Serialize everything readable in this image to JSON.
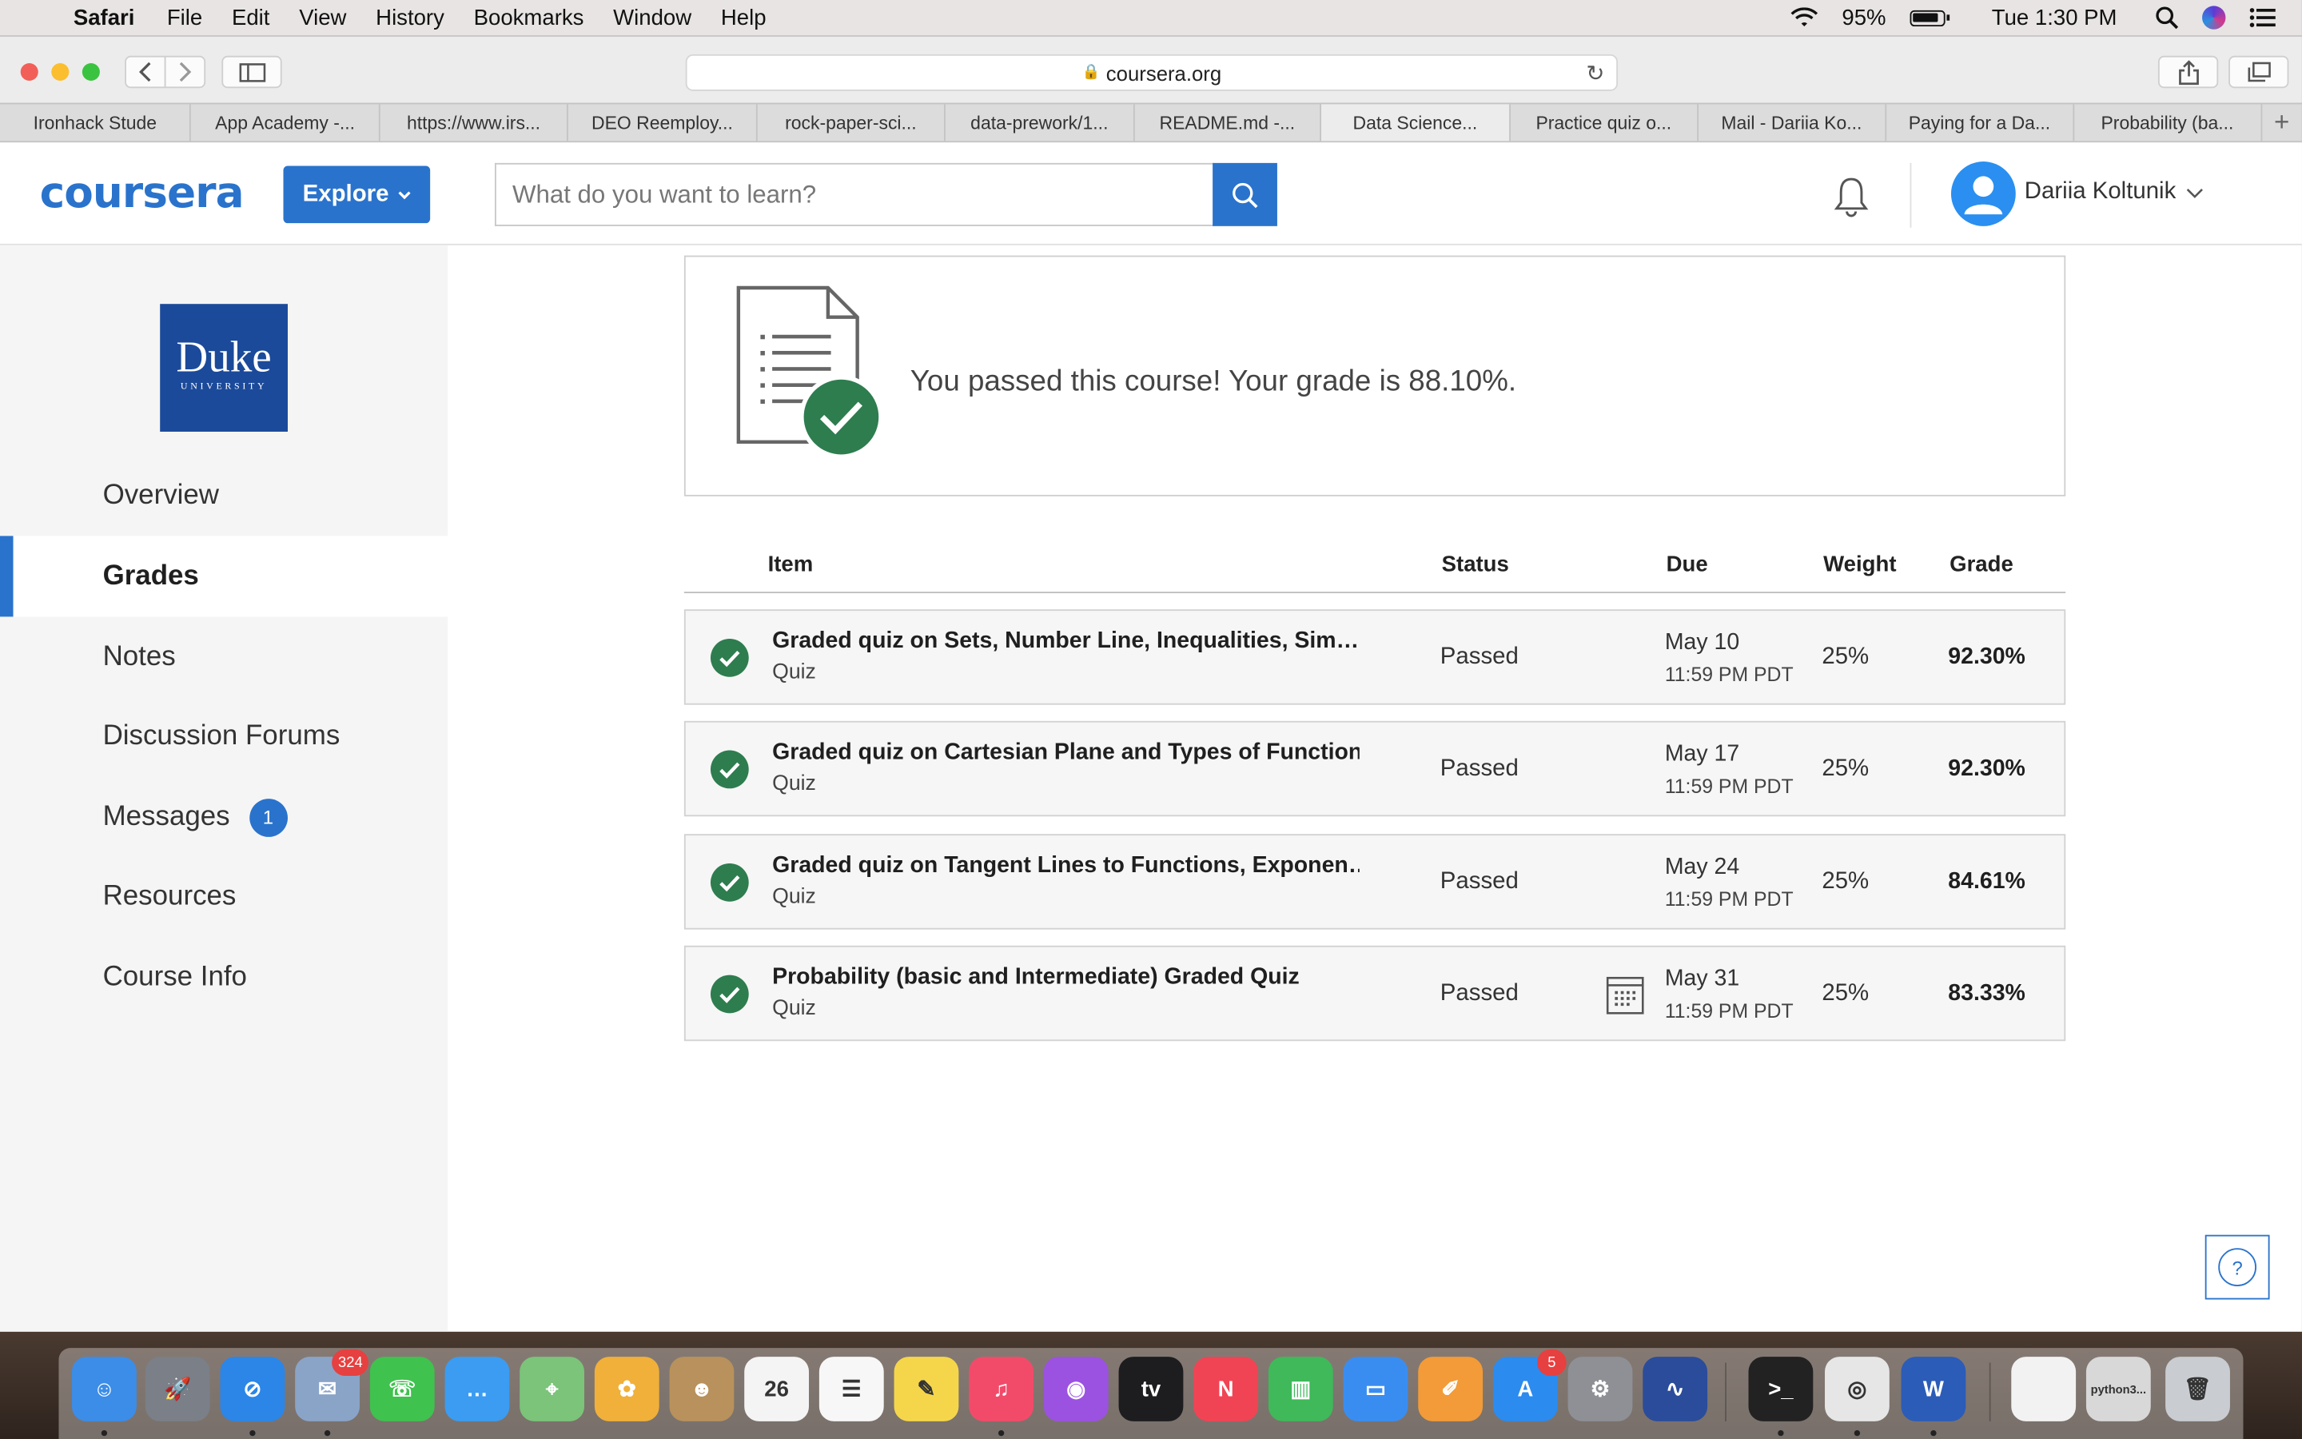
{
  "menubar": {
    "app": "Safari",
    "items": [
      "File",
      "Edit",
      "View",
      "History",
      "Bookmarks",
      "Window",
      "Help"
    ],
    "battery": "95%",
    "clock": "Tue 1:30 PM"
  },
  "browser": {
    "url": "coursera.org",
    "tabs": [
      {
        "label": "Ironhack Stude",
        "active": false
      },
      {
        "label": "App Academy -...",
        "active": false
      },
      {
        "label": "https://www.irs...",
        "active": false
      },
      {
        "label": "DEO Reemploy...",
        "active": false
      },
      {
        "label": "rock-paper-sci...",
        "active": false
      },
      {
        "label": "data-prework/1...",
        "active": false
      },
      {
        "label": "README.md -...",
        "active": false
      },
      {
        "label": "Data Science...",
        "active": true
      },
      {
        "label": "Practice quiz o...",
        "active": false
      },
      {
        "label": "Mail - Dariia Ko...",
        "active": false
      },
      {
        "label": "Paying for a Da...",
        "active": false
      },
      {
        "label": "Probability (ba...",
        "active": false
      }
    ]
  },
  "header": {
    "logo": "coursera",
    "explore": "Explore",
    "search_placeholder": "What do you want to learn?",
    "user_name": "Dariia Koltunik"
  },
  "sidebar": {
    "logo_name": "Duke",
    "logo_sub": "UNIVERSITY",
    "items": [
      {
        "label": "Overview",
        "active": false
      },
      {
        "label": "Grades",
        "active": true
      },
      {
        "label": "Notes",
        "active": false
      },
      {
        "label": "Discussion Forums",
        "active": false
      },
      {
        "label": "Messages",
        "active": false,
        "badge": "1"
      },
      {
        "label": "Resources",
        "active": false
      },
      {
        "label": "Course Info",
        "active": false
      }
    ]
  },
  "banner": {
    "text": "You passed this course! Your grade is 88.10%."
  },
  "table": {
    "headers": {
      "item": "Item",
      "status": "Status",
      "due": "Due",
      "weight": "Weight",
      "grade": "Grade"
    },
    "rows": [
      {
        "title": "Graded quiz on Sets, Number Line, Inequalities, Sim…",
        "type": "Quiz",
        "status": "Passed",
        "due_date": "May 10",
        "due_time": "11:59 PM PDT",
        "weight": "25%",
        "grade": "92.30%"
      },
      {
        "title": "Graded quiz on Cartesian Plane and Types of Function",
        "type": "Quiz",
        "status": "Passed",
        "due_date": "May 17",
        "due_time": "11:59 PM PDT",
        "weight": "25%",
        "grade": "92.30%"
      },
      {
        "title": "Graded quiz on Tangent Lines to Functions, Exponen…",
        "type": "Quiz",
        "status": "Passed",
        "due_date": "May 24",
        "due_time": "11:59 PM PDT",
        "weight": "25%",
        "grade": "84.61%"
      },
      {
        "title": "Probability (basic and Intermediate) Graded Quiz",
        "type": "Quiz",
        "status": "Passed",
        "due_date": "May 31",
        "due_time": "11:59 PM PDT",
        "weight": "25%",
        "grade": "83.33%",
        "calendar_icon": true
      }
    ]
  },
  "help": {
    "label": "?"
  },
  "dock": {
    "apps": [
      {
        "name": "finder-icon",
        "color": "#3c8de8",
        "glyph": "☺",
        "running": true
      },
      {
        "name": "launchpad-icon",
        "color": "#7a7f88",
        "glyph": "🚀",
        "running": false
      },
      {
        "name": "safari-icon",
        "color": "#2b86e8",
        "glyph": "⊘",
        "running": true
      },
      {
        "name": "mail-icon",
        "color": "#8aa4c8",
        "glyph": "✉",
        "running": true,
        "badge": "324"
      },
      {
        "name": "facetime-icon",
        "color": "#3fc24e",
        "glyph": "☏",
        "running": false
      },
      {
        "name": "messages-icon",
        "color": "#3b9cf2",
        "glyph": "…",
        "running": false
      },
      {
        "name": "maps-icon",
        "color": "#7bc47a",
        "glyph": "⌖",
        "running": false
      },
      {
        "name": "photos-icon",
        "color": "#f0b03a",
        "glyph": "✿",
        "running": false
      },
      {
        "name": "contacts-icon",
        "color": "#b8915c",
        "glyph": "☻",
        "running": false
      },
      {
        "name": "calendar-icon",
        "color": "#f4f4f4",
        "glyph": "26",
        "running": false
      },
      {
        "name": "reminders-icon",
        "color": "#f7f7f7",
        "glyph": "☰",
        "running": false
      },
      {
        "name": "notes-icon",
        "color": "#f5d64b",
        "glyph": "✎",
        "running": false
      },
      {
        "name": "music-icon",
        "color": "#f24b6a",
        "glyph": "♫",
        "running": true
      },
      {
        "name": "podcasts-icon",
        "color": "#9b52e0",
        "glyph": "◉",
        "running": false
      },
      {
        "name": "tv-icon",
        "color": "#1d1d1f",
        "glyph": "tv",
        "running": false
      },
      {
        "name": "news-icon",
        "color": "#f04454",
        "glyph": "N",
        "running": false
      },
      {
        "name": "numbers-icon",
        "color": "#3fb95a",
        "glyph": "▥",
        "running": false
      },
      {
        "name": "keynote-icon",
        "color": "#3a8df0",
        "glyph": "▭",
        "running": false
      },
      {
        "name": "pages-icon",
        "color": "#f29b38",
        "glyph": "✐",
        "running": false
      },
      {
        "name": "app-store-icon",
        "color": "#2b8bef",
        "glyph": "A",
        "running": false,
        "badge": "5"
      },
      {
        "name": "system-preferences-icon",
        "color": "#8e9096",
        "glyph": "⚙",
        "running": false
      },
      {
        "name": "voice-memos-icon",
        "color": "#2b4c9a",
        "glyph": "∿",
        "running": false
      },
      {
        "name": "terminal-icon",
        "color": "#222222",
        "glyph": ">_",
        "running": true
      },
      {
        "name": "chrome-icon",
        "color": "#e6e6e6",
        "glyph": "◎",
        "running": true
      },
      {
        "name": "word-icon",
        "color": "#2b5cb8",
        "glyph": "W",
        "running": true
      },
      {
        "name": "document-icon",
        "color": "#f2f2f2",
        "glyph": "",
        "running": false
      },
      {
        "name": "python-window-icon",
        "color": "#d8d8d8",
        "glyph": "python3...",
        "running": false
      },
      {
        "name": "trash-icon",
        "color": "#c9ccd1",
        "glyph": "🗑",
        "running": false
      }
    ]
  }
}
